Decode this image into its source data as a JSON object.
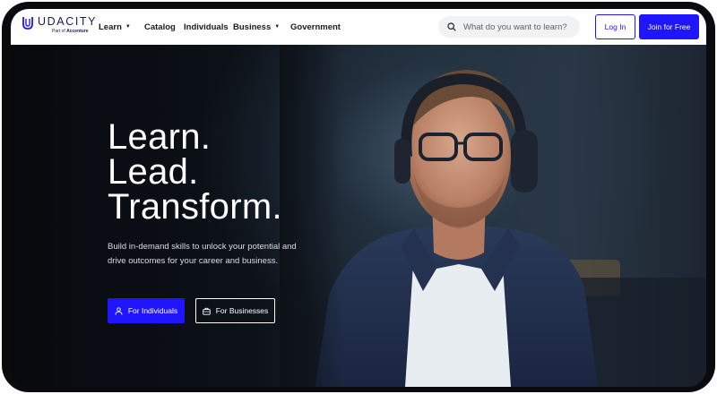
{
  "brand": {
    "name": "UDACITY",
    "tagline_prefix": "Part of",
    "tagline_company": "Accenture",
    "color": "#171a53"
  },
  "nav": {
    "items": [
      {
        "label": "Learn",
        "dropdown": true
      },
      {
        "label": "Catalog",
        "dropdown": false
      },
      {
        "label": "Individuals",
        "dropdown": false
      },
      {
        "label": "Business",
        "dropdown": true
      },
      {
        "label": "Government",
        "dropdown": false
      }
    ],
    "caret_glyph": "▼"
  },
  "search": {
    "placeholder": "What do you want to learn?",
    "icon": "search-icon"
  },
  "auth": {
    "login_label": "Log In",
    "join_label": "Join for Free"
  },
  "hero": {
    "headline": [
      "Learn.",
      "Lead.",
      "Transform."
    ],
    "subtext": "Build in-demand skills to unlock your potential and drive outcomes for your career and business.",
    "cta_individuals": "For Individuals",
    "cta_businesses": "For Businesses",
    "cta_individuals_icon": "user-icon",
    "cta_businesses_icon": "briefcase-icon"
  },
  "colors": {
    "accent": "#2015ff",
    "hero_text": "#ffffff"
  }
}
